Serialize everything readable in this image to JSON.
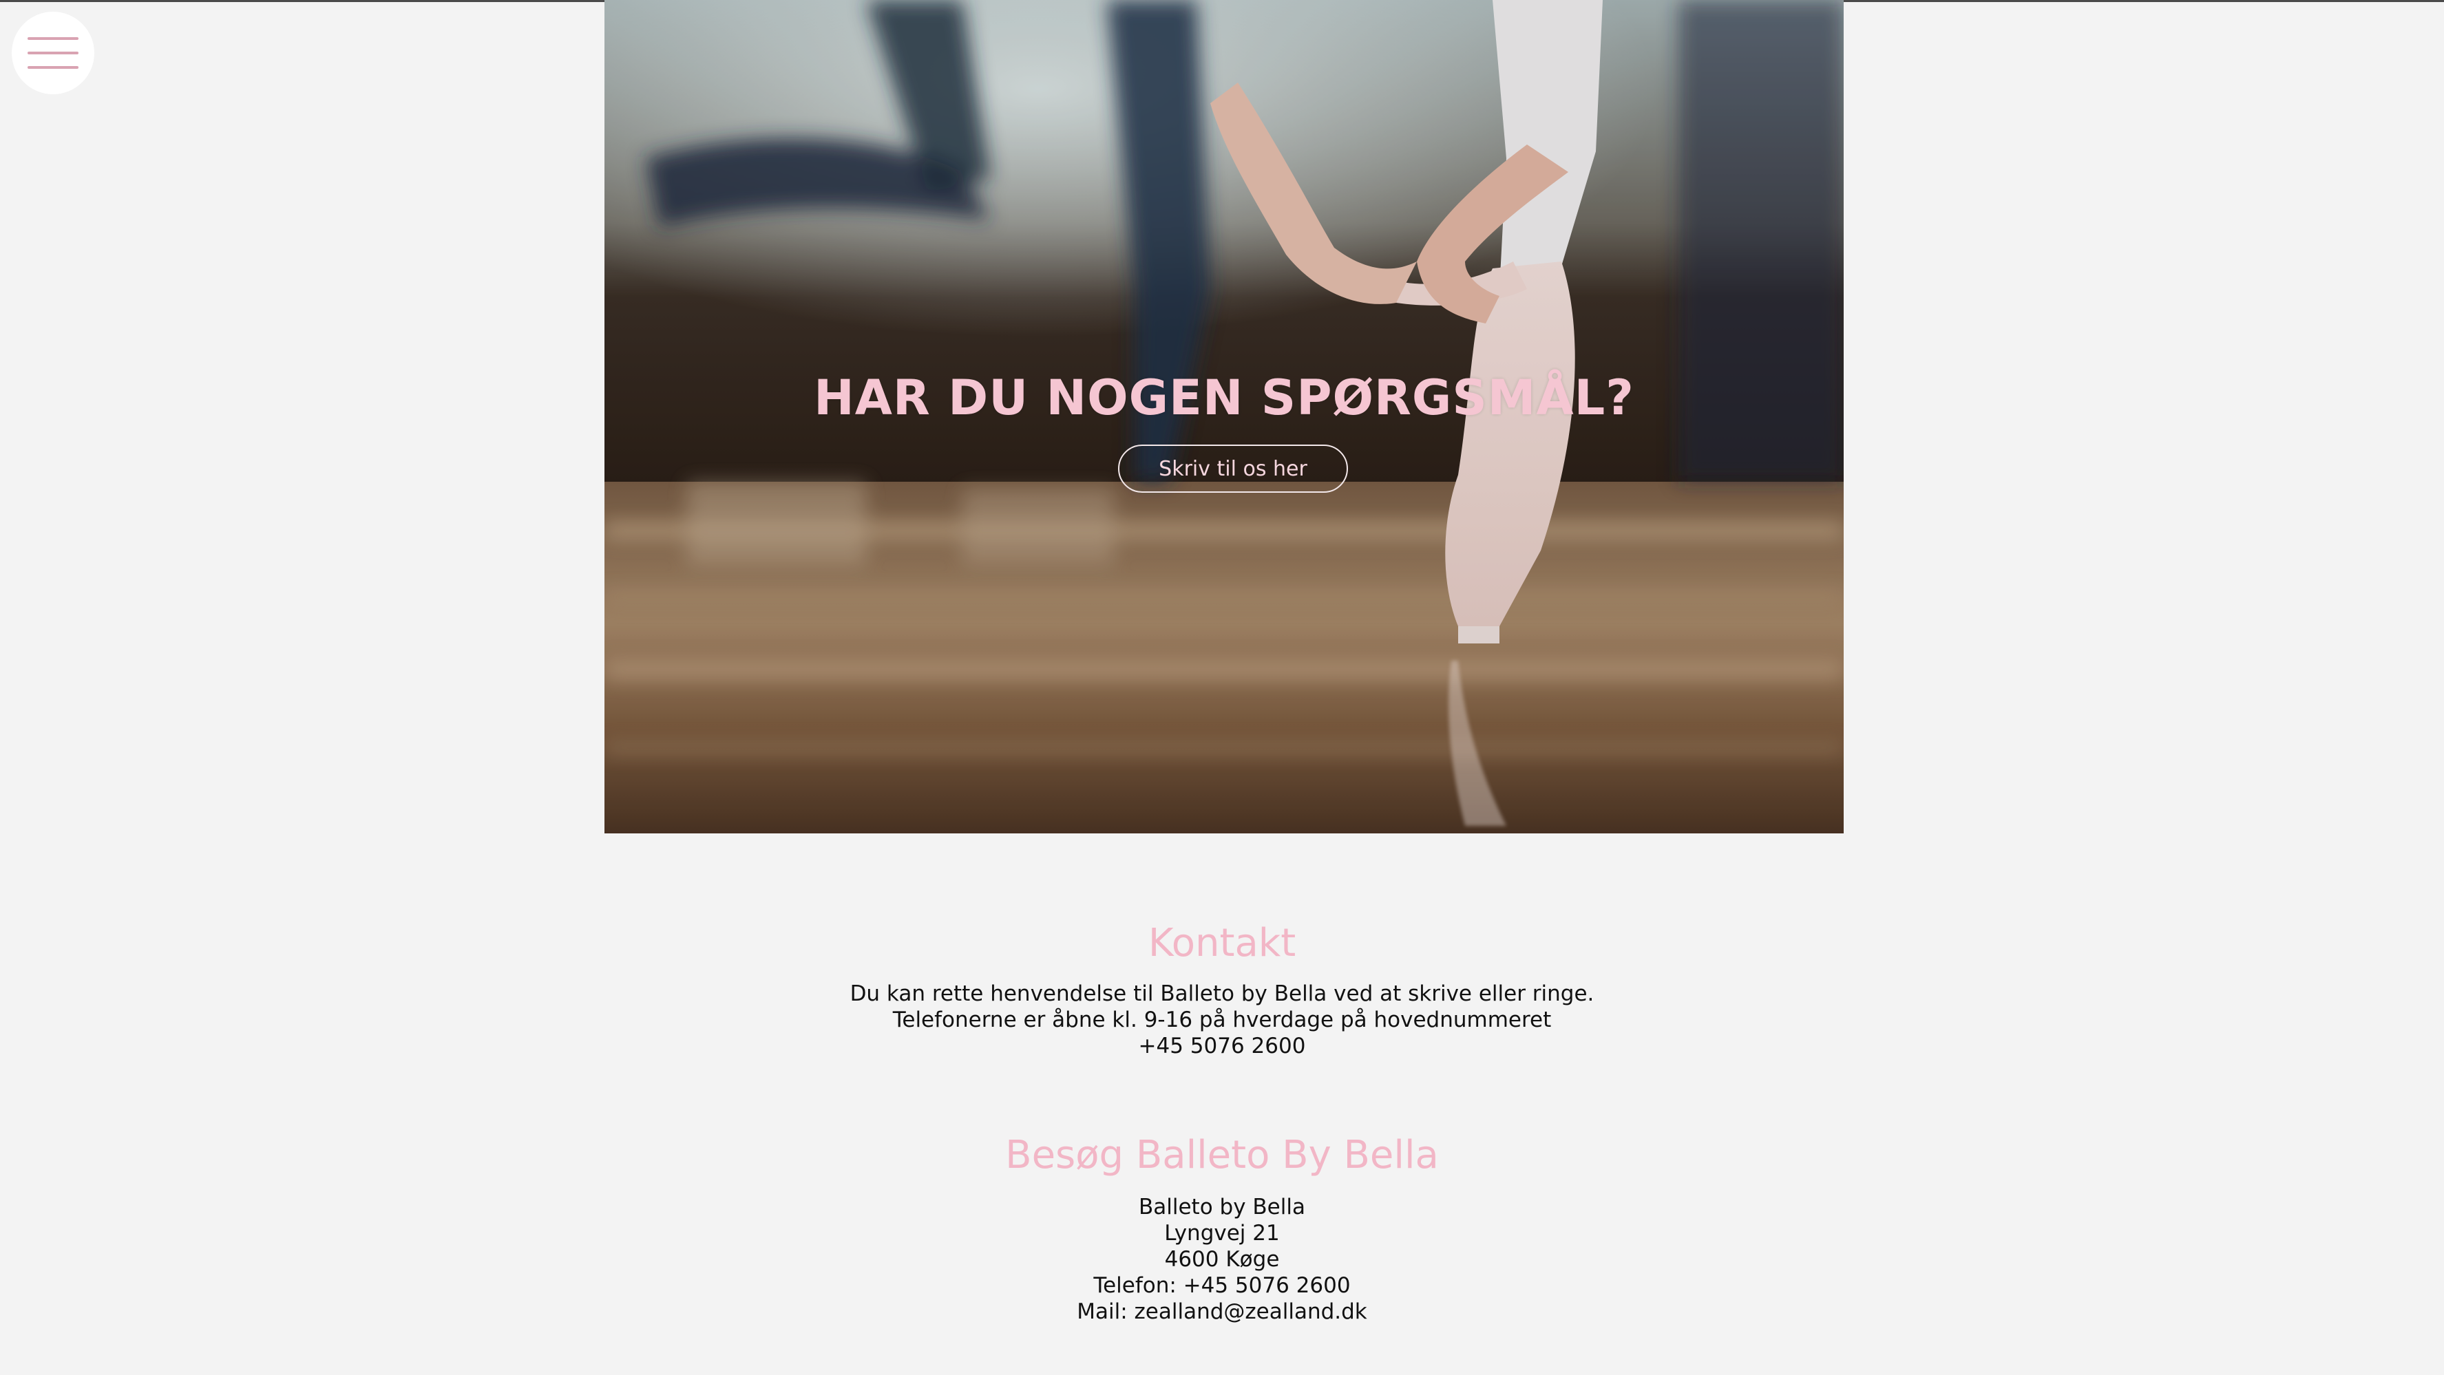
{
  "nav": {
    "menu_icon": "hamburger-menu-icon"
  },
  "hero": {
    "title": "HAR DU NOGEN SPØRGSMÅL?",
    "cta_label": "Skriv til os her"
  },
  "contact": {
    "heading": "Kontakt",
    "lines": [
      "Du kan rette henvendelse til Balleto by Bella ved at skrive eller ringe.",
      "Telefonerne er åbne kl. 9-16 på hverdage på hovednummeret",
      "+45 5076 2600"
    ]
  },
  "visit": {
    "heading": "Besøg Balleto By Bella",
    "lines": [
      "Balleto by Bella",
      "Lyngvej 21",
      "4600 Køge",
      "Telefon: +45 5076 2600",
      "Mail: zealland@zealland.dk"
    ]
  },
  "colors": {
    "accent_pink": "#f2b6c6",
    "background": "#f3f3f3",
    "text": "#111111"
  }
}
